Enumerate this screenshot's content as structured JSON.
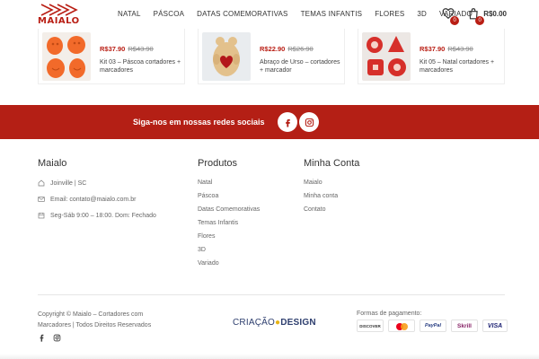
{
  "brand": {
    "logo_text": "MAIALO",
    "color": "#b41f15"
  },
  "nav": {
    "items": [
      "NATAL",
      "PÁSCOA",
      "DATAS COMEMORATIVAS",
      "TEMAS INFANTIS",
      "FLORES",
      "3D",
      "VARIADO"
    ]
  },
  "header": {
    "wishlist_count": "0",
    "cart_count": "0",
    "cart_total": "R$0.00"
  },
  "products": [
    {
      "price": "R$37.90",
      "old_price": "R$43.90",
      "name": "Kit 03 – Páscoa cortadores + marcadores",
      "image": "easter-cutters"
    },
    {
      "price": "R$22.90",
      "old_price": "R$26.90",
      "name": "Abraço de Urso – cortadores + marcador",
      "image": "bear-cookie"
    },
    {
      "price": "R$37.90",
      "old_price": "R$43.90",
      "name": "Kit 05 – Natal cortadores + marcadores",
      "image": "christmas-cutters"
    }
  ],
  "social": {
    "label": "Siga-nos em nossas redes sociais",
    "icons": [
      "facebook-icon",
      "instagram-icon"
    ]
  },
  "footer": {
    "col1": {
      "title": "Maialo",
      "location": "Joinville | SC",
      "email": "Email: contato@maialo.com.br",
      "hours": "Seg-Sáb 9:00 – 18:00. Dom: Fechado"
    },
    "col2": {
      "title": "Produtos",
      "links": [
        "Natal",
        "Páscoa",
        "Datas Comemorativas",
        "Temas Infantis",
        "Flores",
        "3D",
        "Variado"
      ]
    },
    "col3": {
      "title": "Minha Conta",
      "links": [
        "Maialo",
        "Minha conta",
        "Contato"
      ]
    },
    "copyright_line1": "Copyright © Maialo – Cortadores com",
    "copyright_line2": "Marcadores | Todos Direitos Reservados",
    "credit_a": "CRIAÇÃO",
    "credit_b": "DESIGN",
    "payment_label": "Formas de pagamento:",
    "payments": [
      "DISCOVER",
      "MasterCard",
      "PayPal",
      "Skrill",
      "VISA"
    ]
  }
}
